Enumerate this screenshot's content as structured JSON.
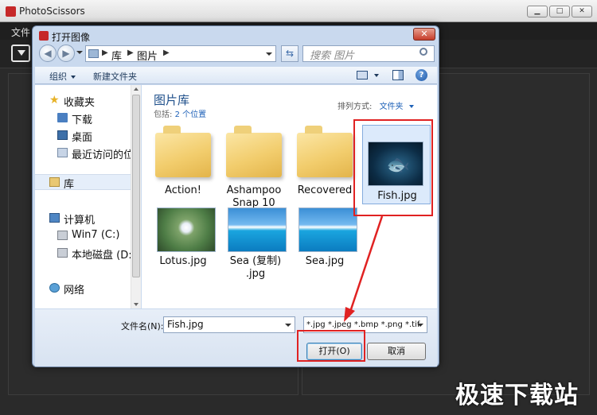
{
  "app": {
    "title": "PhotoScissors",
    "menu_file": "文件",
    "window_buttons": [
      "▁",
      "□",
      "✕"
    ]
  },
  "dialog": {
    "title": "打开图像",
    "close_label": "✕",
    "address": {
      "items": [
        "库",
        "图片"
      ],
      "sep": "▶"
    },
    "search_placeholder": "搜索 图片",
    "command_bar": {
      "organize": "组织",
      "new_folder": "新建文件夹"
    },
    "nav_pane": {
      "favorites": "收藏夹",
      "downloads": "下载",
      "desktop": "桌面",
      "recent": "最近访问的位置",
      "libraries": "库",
      "computer": "计算机",
      "drive_c": "Win7 (C:)",
      "drive_d": "本地磁盘 (D:)",
      "network": "网络"
    },
    "library_header": {
      "title": "图片库",
      "includes_label": "包括:",
      "includes_link": "2 个位置",
      "arrange_label": "排列方式:",
      "arrange_value": "文件夹"
    },
    "files": [
      {
        "name": "Action!",
        "kind": "folder"
      },
      {
        "name": "Ashampoo Snap 10",
        "kind": "folder"
      },
      {
        "name": "Recovered",
        "kind": "folder"
      },
      {
        "name": "Fish.jpg",
        "kind": "image",
        "selected": true
      },
      {
        "name": "Lotus.jpg",
        "kind": "image"
      },
      {
        "name": "Sea (复制) .jpg",
        "kind": "image"
      },
      {
        "name": "Sea.jpg",
        "kind": "image"
      }
    ],
    "filename_label": "文件名(N):",
    "filename_value": "Fish.jpg",
    "filter_value": "*.jpg *.jpeg *.bmp *.png *.tif",
    "open_button": "打开(O)",
    "cancel_button": "取消"
  },
  "watermark": "极速下载站",
  "colors": {
    "highlight_red": "#e02222",
    "link_blue": "#1f62b8",
    "app_dark": "#2a2a2a"
  }
}
